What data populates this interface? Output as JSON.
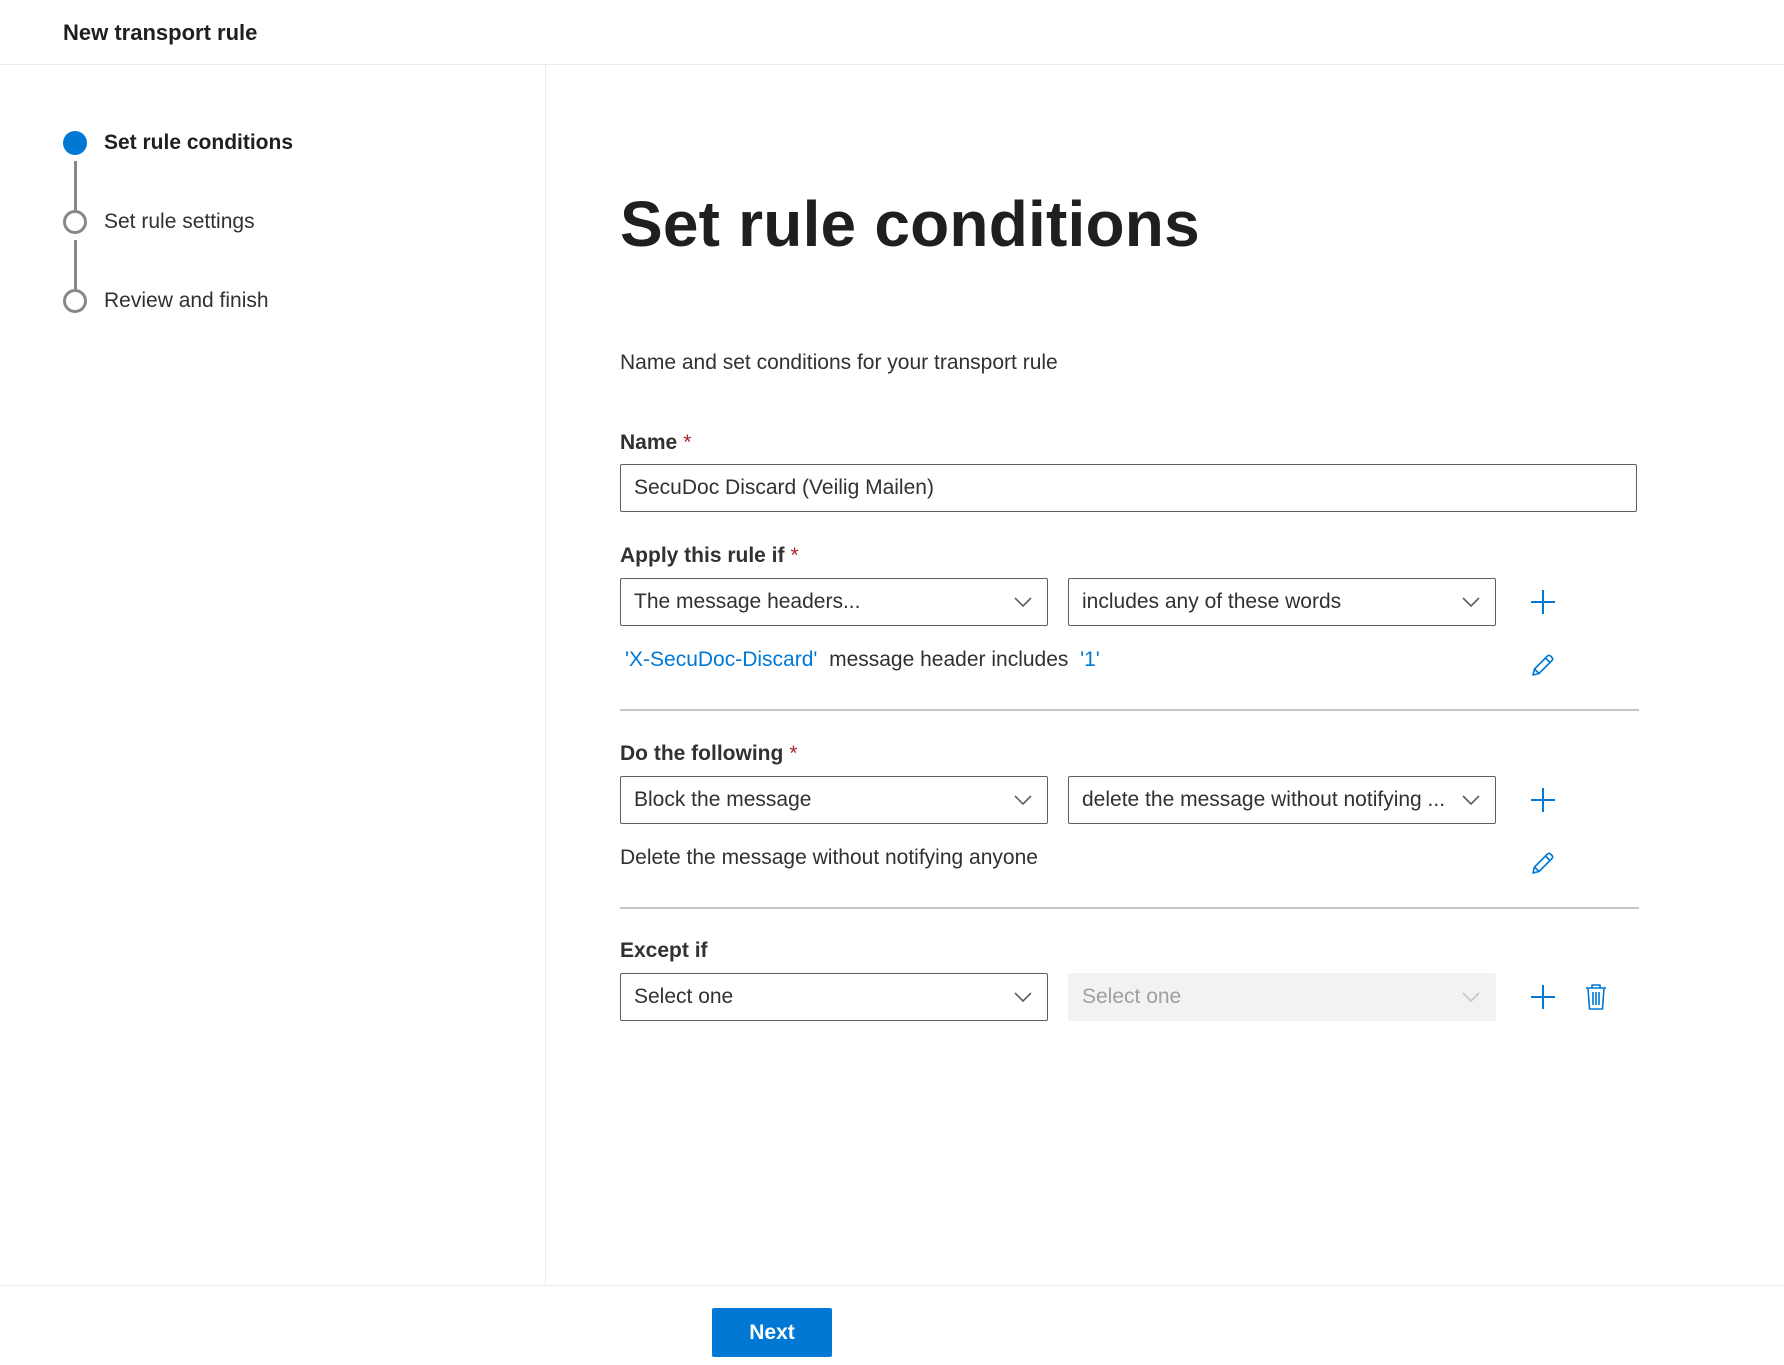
{
  "header": {
    "title": "New transport rule"
  },
  "wizard": {
    "steps": [
      {
        "label": "Set rule conditions",
        "state": "current"
      },
      {
        "label": "Set rule settings",
        "state": "pending"
      },
      {
        "label": "Review and finish",
        "state": "pending"
      }
    ]
  },
  "main": {
    "title": "Set rule conditions",
    "subtitle": "Name and set conditions for your transport rule",
    "name": {
      "label": "Name",
      "required_mark": "*",
      "value": "SecuDoc Discard (Veilig Mailen)"
    },
    "apply_if": {
      "label": "Apply this rule if",
      "required_mark": "*",
      "condition": "The message headers...",
      "operator": "includes any of these words",
      "summary": {
        "header_name": "'X-SecuDoc-Discard'",
        "middle": "message header includes",
        "value": "'1'"
      }
    },
    "do_following": {
      "label": "Do the following",
      "required_mark": "*",
      "action": "Block the message",
      "action_detail": "delete the message without notifying ...",
      "summary": "Delete the message without notifying anyone"
    },
    "except_if": {
      "label": "Except if",
      "condition": "Select one",
      "operator": "Select one"
    }
  },
  "footer": {
    "next_label": "Next"
  },
  "colors": {
    "accent": "#0078d4",
    "required": "#a4262c",
    "text": "#323130",
    "border": "#605e5c"
  },
  "icons": [
    "chevron-down-icon",
    "add-icon",
    "edit-icon",
    "delete-icon"
  ]
}
